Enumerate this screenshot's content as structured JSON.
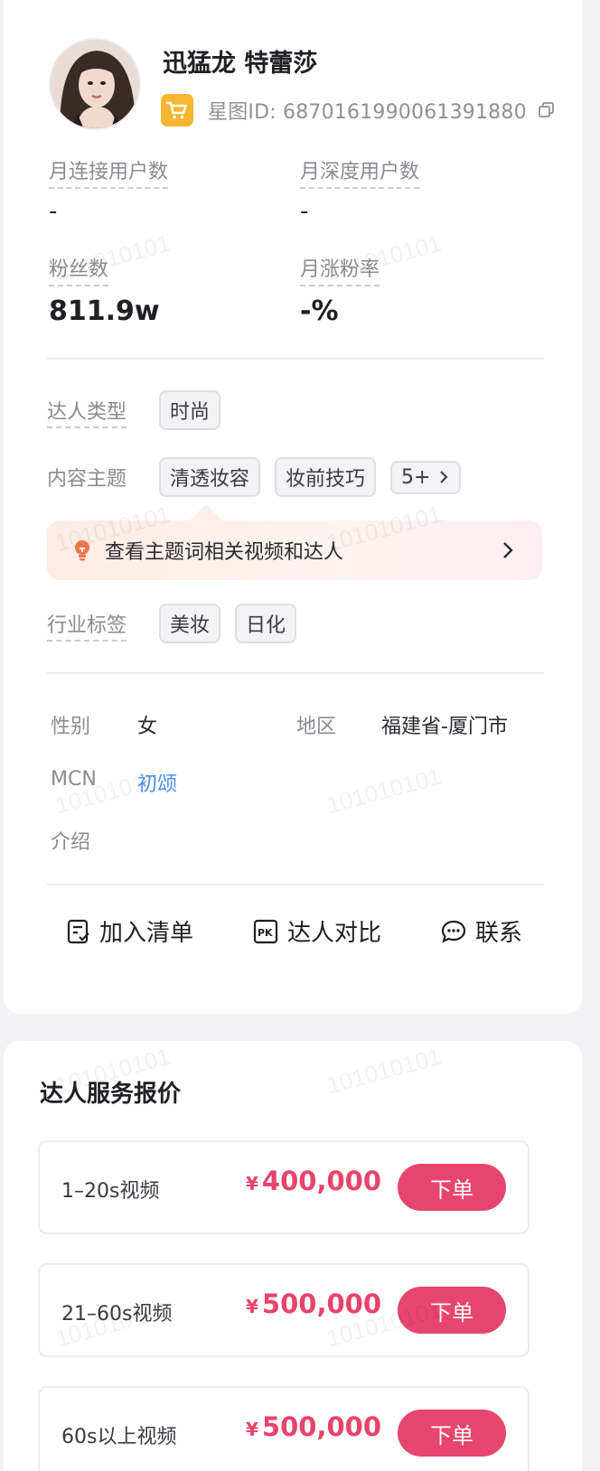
{
  "profile": {
    "name": "迅猛龙 特蕾莎",
    "star_id_label": "星图ID: 6870161990061391880"
  },
  "metrics": [
    {
      "label": "月连接用户数",
      "value": "-"
    },
    {
      "label": "月深度用户数",
      "value": "-"
    },
    {
      "label": "粉丝数",
      "value": "811.9w"
    },
    {
      "label": "月涨粉率",
      "value": "-%"
    }
  ],
  "tags": {
    "type_label": "达人类型",
    "type_tags": [
      "时尚"
    ],
    "topic_label": "内容主题",
    "topic_tags": [
      "清透妆容",
      "妆前技巧"
    ],
    "topic_more": "5+",
    "industry_label": "行业标签",
    "industry_tags": [
      "美妆",
      "日化"
    ]
  },
  "topic_banner": {
    "text": "查看主题词相关视频和达人"
  },
  "info": {
    "gender_label": "性别",
    "gender_value": "女",
    "region_label": "地区",
    "region_value": "福建省-厦门市",
    "mcn_label": "MCN",
    "mcn_value": "初颂",
    "intro_label": "介绍"
  },
  "actions": {
    "add_list": "加入清单",
    "compare": "达人对比",
    "contact": "联系"
  },
  "pricing": {
    "title": "达人服务报价",
    "currency": "¥",
    "order_label": "下单",
    "rows": [
      {
        "name": "1–20s视频",
        "price": "400,000"
      },
      {
        "name": "21–60s视频",
        "price": "500,000"
      },
      {
        "name": "60s以上视频",
        "price": "500,000"
      }
    ]
  },
  "watermark_text": "101010101",
  "colors": {
    "accent": "#e6456e",
    "link": "#4a8ef0",
    "badge": "#f5b731"
  }
}
